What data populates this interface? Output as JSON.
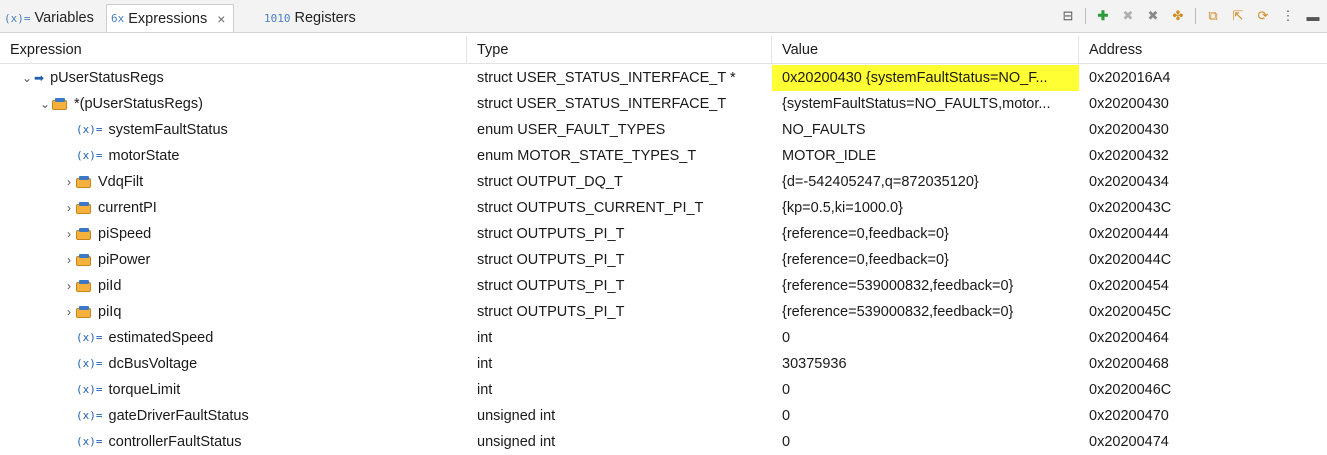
{
  "tabs": [
    {
      "icon": "(x)=",
      "label": "Variables"
    },
    {
      "icon": "6x",
      "label": "Expressions",
      "close": "×"
    },
    {
      "icon": "1010",
      "label": "Registers"
    }
  ],
  "header": {
    "expression": "Expression",
    "type": "Type",
    "value": "Value",
    "address": "Address"
  },
  "rows": [
    {
      "expr": "pUserStatusRegs",
      "type": "struct USER_STATUS_INTERFACE_T *",
      "value": "0x20200430 {systemFaultStatus=NO_F...",
      "address": "0x202016A4"
    },
    {
      "expr": "*(pUserStatusRegs)",
      "type": "struct USER_STATUS_INTERFACE_T",
      "value": "{systemFaultStatus=NO_FAULTS,motor...",
      "address": "0x20200430"
    },
    {
      "expr": "systemFaultStatus",
      "type": "enum USER_FAULT_TYPES",
      "value": "NO_FAULTS",
      "address": "0x20200430"
    },
    {
      "expr": "motorState",
      "type": "enum MOTOR_STATE_TYPES_T",
      "value": "MOTOR_IDLE",
      "address": "0x20200432"
    },
    {
      "expr": "VdqFilt",
      "type": "struct OUTPUT_DQ_T",
      "value": "{d=-542405247,q=872035120}",
      "address": "0x20200434"
    },
    {
      "expr": "currentPI",
      "type": "struct OUTPUTS_CURRENT_PI_T",
      "value": "{kp=0.5,ki=1000.0}",
      "address": "0x2020043C"
    },
    {
      "expr": "piSpeed",
      "type": "struct OUTPUTS_PI_T",
      "value": "{reference=0,feedback=0}",
      "address": "0x20200444"
    },
    {
      "expr": "piPower",
      "type": "struct OUTPUTS_PI_T",
      "value": "{reference=0,feedback=0}",
      "address": "0x2020044C"
    },
    {
      "expr": "piId",
      "type": "struct OUTPUTS_PI_T",
      "value": "{reference=539000832,feedback=0}",
      "address": "0x20200454"
    },
    {
      "expr": "piIq",
      "type": "struct OUTPUTS_PI_T",
      "value": "{reference=539000832,feedback=0}",
      "address": "0x2020045C"
    },
    {
      "expr": "estimatedSpeed",
      "type": "int",
      "value": "0",
      "address": "0x20200464"
    },
    {
      "expr": "dcBusVoltage",
      "type": "int",
      "value": "30375936",
      "address": "0x20200468"
    },
    {
      "expr": "torqueLimit",
      "type": "int",
      "value": "0",
      "address": "0x2020046C"
    },
    {
      "expr": "gateDriverFaultStatus",
      "type": "unsigned int",
      "value": "0",
      "address": "0x20200470"
    },
    {
      "expr": "controllerFaultStatus",
      "type": "unsigned int",
      "value": "0",
      "address": "0x20200474"
    }
  ],
  "icons": {
    "twisty_open": "⌄",
    "twisty_closed": "›",
    "pointer": "➡",
    "variable": "(x)="
  },
  "colors": {
    "highlight": "#ffff33",
    "struct_icon": "#f4b13d",
    "accent": "#1f5fb0"
  }
}
